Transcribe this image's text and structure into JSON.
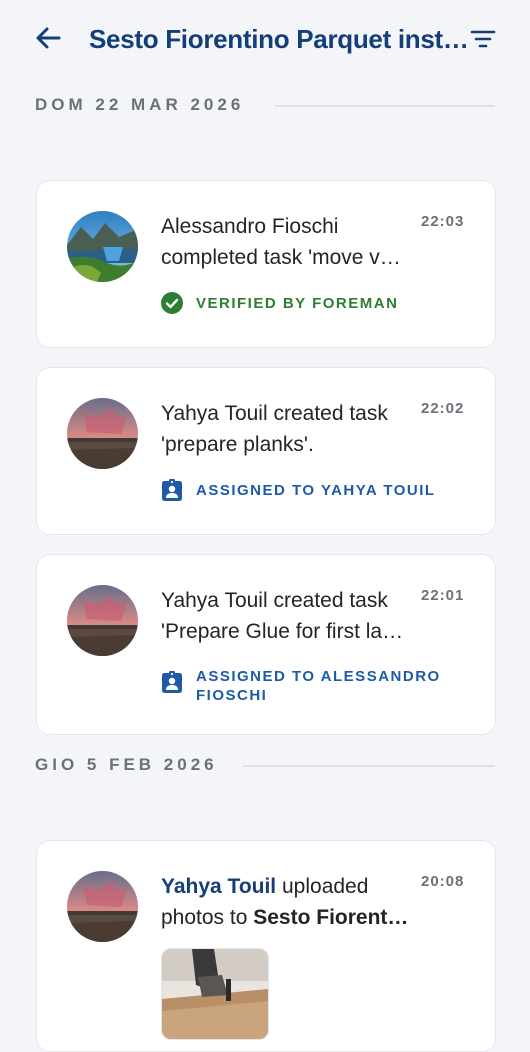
{
  "header": {
    "title": "Sesto Fiorentino Parquet inst…",
    "back_icon": "arrow-left-icon",
    "filter_icon": "filter-icon"
  },
  "groups": [
    {
      "date": "DOM 22 MAR 2026",
      "entries": [
        {
          "lines": [
            "Alessandro Fioschi",
            "completed task 'move v…"
          ],
          "time": "22:03",
          "badge": [
            "VERIFIED BY FOREMAN"
          ],
          "badge_icon": "check-circle-icon",
          "badge_color": "#2e7d32"
        },
        {
          "lines": [
            "Yahya Touil created task",
            "'prepare planks'."
          ],
          "time": "22:02",
          "badge": [
            "ASSIGNED TO YAHYA TOUIL"
          ],
          "badge_icon": "assignment-ind-icon",
          "badge_color": "#1e5aa8"
        },
        {
          "lines": [
            "Yahya Touil created task",
            "'Prepare Glue for first la…"
          ],
          "time": "22:01",
          "badge": [
            "ASSIGNED TO ALESSANDRO",
            "FIOSCHI"
          ],
          "badge_icon": "assignment-ind-icon",
          "badge_color": "#1e5aa8"
        }
      ]
    },
    {
      "date": "GIO 5 FEB 2026",
      "entries": [
        {
          "actor": "Yahya Touil",
          "action": " uploaded",
          "prefix": "photos to ",
          "project": "Sesto Fiorent…",
          "time": "20:08"
        }
      ]
    }
  ],
  "colors": {
    "accent": "#143e78",
    "background": "#f3f5f9",
    "muted": "#6b7079"
  }
}
